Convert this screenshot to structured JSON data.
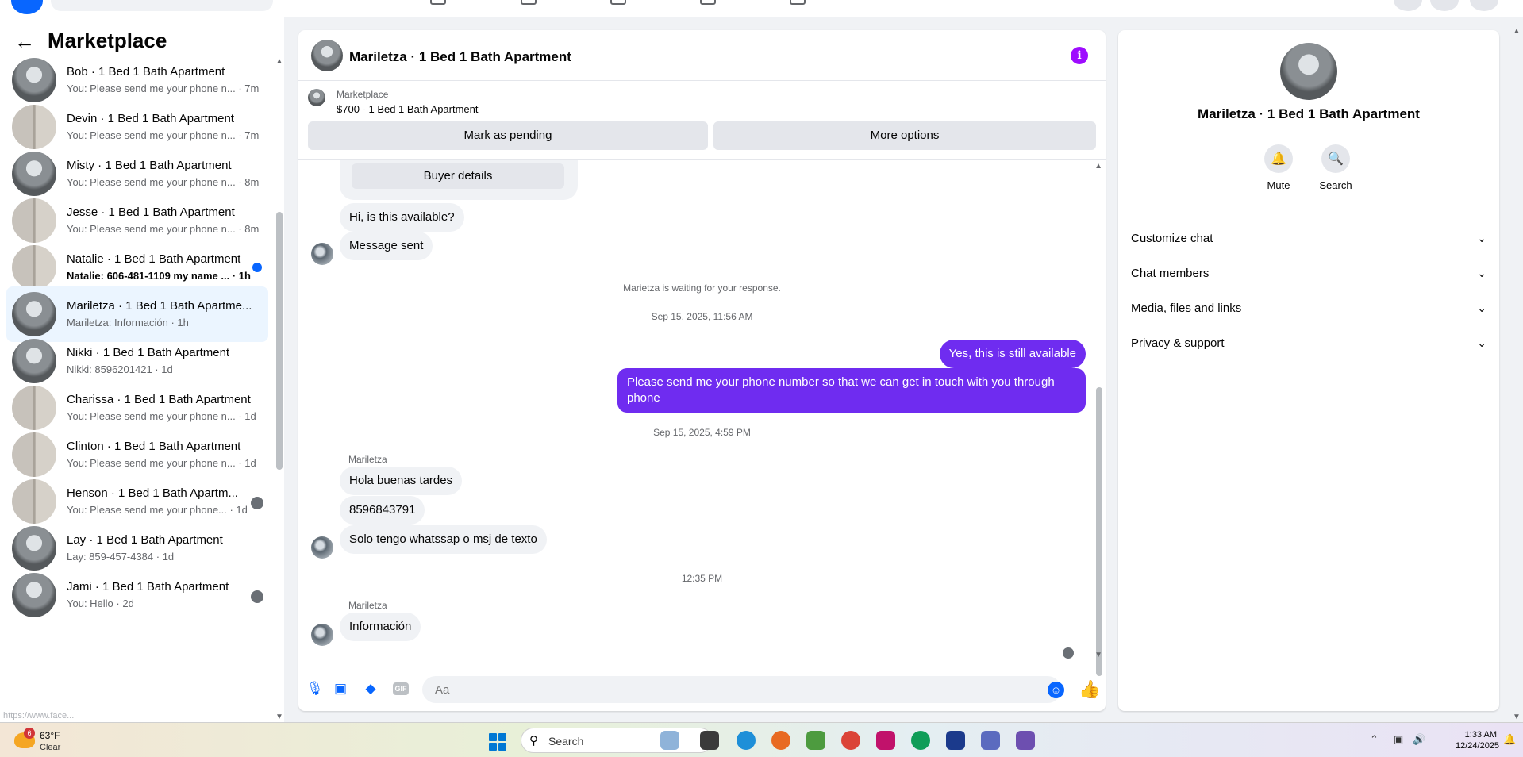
{
  "sidebar": {
    "title": "Marketplace",
    "url_hint": "https://www.face...",
    "conversations": [
      {
        "name": "Bob · 1 Bed 1 Bath Apartment",
        "preview": "You: Please send me your phone n... · 7m",
        "avatar": "room"
      },
      {
        "name": "Devin · 1 Bed 1 Bath Apartment",
        "preview": "You: Please send me your phone n... · 7m",
        "avatar": "door"
      },
      {
        "name": "Misty · 1 Bed 1 Bath Apartment",
        "preview": "You: Please send me your phone n... · 8m",
        "avatar": "room"
      },
      {
        "name": "Jesse · 1 Bed 1 Bath Apartment",
        "preview": "You: Please send me your phone n... · 8m",
        "avatar": "door"
      },
      {
        "name": "Natalie · 1 Bed 1 Bath Apartment",
        "preview": "Natalie: 606-481-1109 my name ... · 1h",
        "avatar": "door",
        "unread": true
      },
      {
        "name": "Mariletza · 1 Bed 1 Bath Apartme...",
        "preview": "Mariletza: Información · 1h",
        "avatar": "room",
        "active": true
      },
      {
        "name": "Nikki · 1 Bed 1 Bath Apartment",
        "preview": "Nikki: 8596201421 · 1d",
        "avatar": "room"
      },
      {
        "name": "Charissa · 1 Bed 1 Bath Apartment",
        "preview": "You: Please send me your phone n... · 1d",
        "avatar": "door"
      },
      {
        "name": "Clinton · 1 Bed 1 Bath Apartment",
        "preview": "You: Please send me your phone n... · 1d",
        "avatar": "door"
      },
      {
        "name": "Henson · 1 Bed 1 Bath Apartm...",
        "preview": "You: Please send me your phone... · 1d",
        "avatar": "door",
        "seen": true
      },
      {
        "name": "Lay · 1 Bed 1 Bath Apartment",
        "preview": "Lay: 859-457-4384 · 1d",
        "avatar": "room"
      },
      {
        "name": "Jami · 1 Bed 1 Bath Apartment",
        "preview": "You: Hello · 2d",
        "avatar": "room",
        "seen": true
      }
    ]
  },
  "chat": {
    "title": "Mariletza · 1 Bed 1 Bath Apartment",
    "listing_label": "Marketplace",
    "listing_price": "$700 - 1 Bed 1 Bath Apartment",
    "mark_pending": "Mark as pending",
    "more_options": "More options",
    "buyer_details": "Buyer details",
    "messages": {
      "m1": "Hi, is this available?",
      "m2": "Message sent",
      "waiting": "Marietza is waiting for your response.",
      "ts1": "Sep 15, 2025, 11:56 AM",
      "out1": "Yes, this is still available",
      "out2_line1": "Please send me your phone  number so that we can get in touch with you through",
      "out2_line2": "phone",
      "ts2": "Sep 15, 2025, 4:59 PM",
      "sender1": "Mariletza",
      "in1": "Hola buenas tardes",
      "in2": "8596843791",
      "in3": "Solo tengo whatssap o msj de texto",
      "ts3": "12:35 PM",
      "sender2": "Mariletza",
      "in4": "Información"
    },
    "composer_placeholder": "Aa",
    "gif_label": "GIF"
  },
  "rpanel": {
    "name": "Mariletza · 1 Bed 1 Bath Apartment",
    "mute": "Mute",
    "search": "Search",
    "sections": [
      "Customize chat",
      "Chat members",
      "Media, files and links",
      "Privacy & support"
    ]
  },
  "taskbar": {
    "temp": "63°F",
    "condition": "Clear",
    "weather_badge": "6",
    "search": "Search",
    "time": "1:33 AM",
    "date": "12/24/2025"
  },
  "colors": {
    "accent": "#0866ff",
    "outgoing_bubble": "#6f2cf0",
    "info": "#9e0cff"
  }
}
